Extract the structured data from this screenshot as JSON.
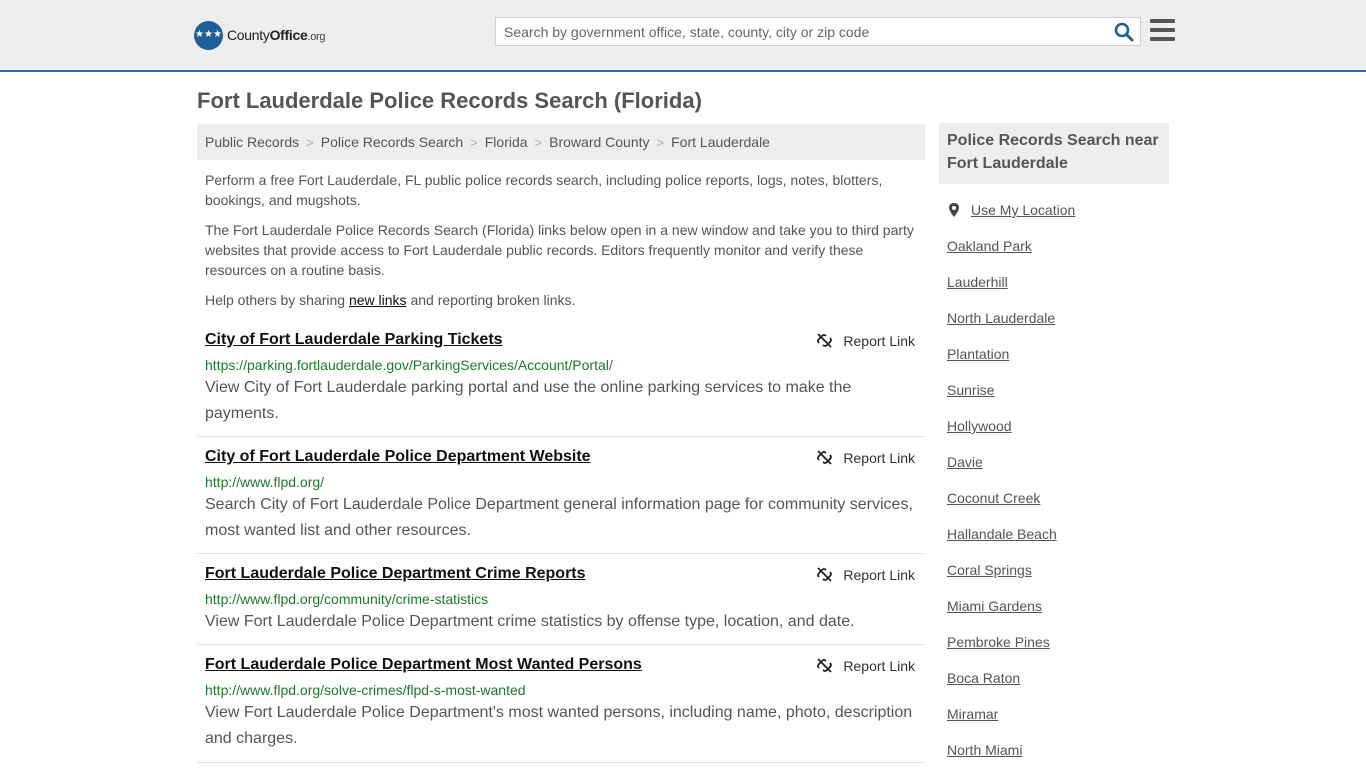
{
  "header": {
    "logo_name": "County",
    "logo_strong": "Office",
    "logo_suffix": ".org",
    "search_placeholder": "Search by government office, state, county, city or zip code",
    "accent_color": "#2b6cb0"
  },
  "page_title": "Fort Lauderdale Police Records Search (Florida)",
  "breadcrumb": [
    "Public Records",
    "Police Records Search",
    "Florida",
    "Broward County",
    "Fort Lauderdale"
  ],
  "intro": {
    "p1": "Perform a free Fort Lauderdale, FL public police records search, including police reports, logs, notes, blotters, bookings, and mugshots.",
    "p2": "The Fort Lauderdale Police Records Search (Florida) links below open in a new window and take you to third party websites that provide access to Fort Lauderdale public records. Editors frequently monitor and verify these resources on a routine basis.",
    "p3_before": "Help others by sharing ",
    "p3_link": "new links",
    "p3_after": " and reporting broken links."
  },
  "report_label": "Report Link",
  "results": [
    {
      "title": "City of Fort Lauderdale Parking Tickets",
      "url": "https://parking.fortlauderdale.gov/ParkingServices/Account/Portal/",
      "desc": "View City of Fort Lauderdale parking portal and use the online parking services to make the payments."
    },
    {
      "title": "City of Fort Lauderdale Police Department Website",
      "url": "http://www.flpd.org/",
      "desc": "Search City of Fort Lauderdale Police Department general information page for community services, most wanted list and other resources."
    },
    {
      "title": "Fort Lauderdale Police Department Crime Reports",
      "url": "http://www.flpd.org/community/crime-statistics",
      "desc": "View Fort Lauderdale Police Department crime statistics by offense type, location, and date."
    },
    {
      "title": "Fort Lauderdale Police Department Most Wanted Persons",
      "url": "http://www.flpd.org/solve-crimes/flpd-s-most-wanted",
      "desc": "View Fort Lauderdale Police Department's most wanted persons, including name, photo, description and charges."
    }
  ],
  "sidebar": {
    "heading": "Police Records Search near Fort Lauderdale",
    "use_location": "Use My Location",
    "cities": [
      "Oakland Park",
      "Lauderhill",
      "North Lauderdale",
      "Plantation",
      "Sunrise",
      "Hollywood",
      "Davie",
      "Coconut Creek",
      "Hallandale Beach",
      "Coral Springs",
      "Miami Gardens",
      "Pembroke Pines",
      "Boca Raton",
      "Miramar",
      "North Miami"
    ]
  }
}
